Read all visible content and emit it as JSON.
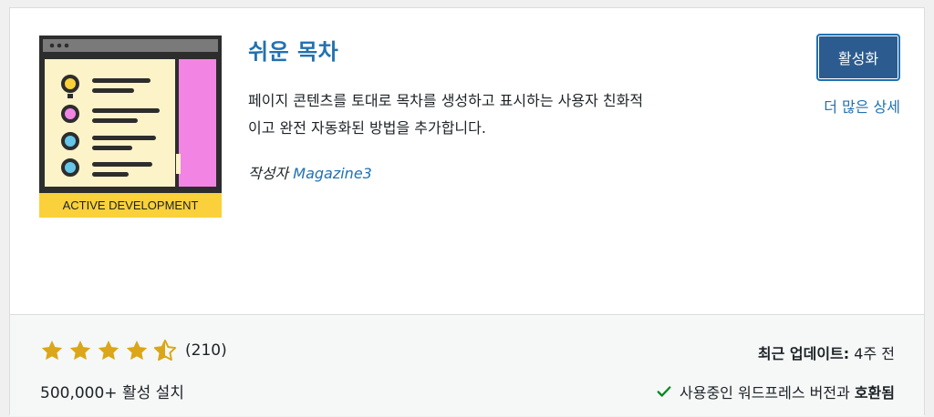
{
  "plugin": {
    "name": "쉬운 목차",
    "description_line1": "페이지 콘텐츠를 토대로 목차를 생성하고 표시하는 사용자 친화적",
    "description_line2": "이고 완전 자동화된 방법을 추가합니다.",
    "author_prefix": "작성자",
    "author_name": "Magazine3",
    "icon_banner_text": "ACTIVE DEVELOPMENT"
  },
  "actions": {
    "activate_label": "활성화",
    "more_details_label": "더 많은 상세"
  },
  "stats": {
    "rating_stars": 4.5,
    "rating_count": "(210)",
    "installs": "500,000+ 활성 설치",
    "last_updated_label": "최근 업데이트:",
    "last_updated_value": "4주 전",
    "compat_text": "사용중인 워드프레스 버전과",
    "compat_status": "호환됨"
  },
  "colors": {
    "link": "#2271b1",
    "button_bg": "#2c5c8f",
    "star": "#dba617",
    "check": "#008a20",
    "icon_pink": "#f285e4",
    "icon_cream": "#fdf3c8",
    "icon_banner": "#fad13a"
  }
}
